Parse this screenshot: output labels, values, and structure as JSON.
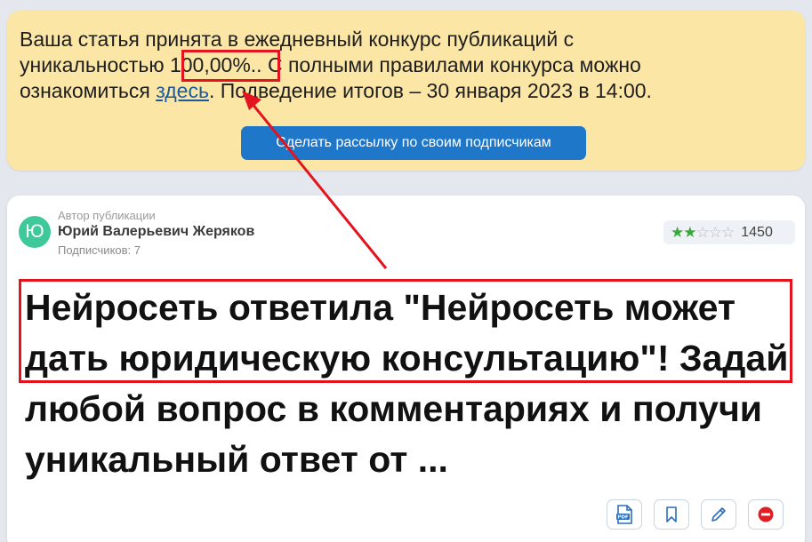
{
  "notice": {
    "line1": "Ваша статья принята в ежедневный конкурс публикаций с",
    "line2_prefix": "уникальностью ",
    "uniqueness": "100,00%.",
    "line2_suffix": ". С полными правилами конкурса можно",
    "line3_prefix": "ознакомиться ",
    "link_text": "здесь",
    "line3_suffix": ". Подведение итогов – 30 января 2023 в 14:00.",
    "button_label": "Сделать рассылку по своим подписчикам"
  },
  "author": {
    "avatar_letter": "Ю",
    "caption": "Автор публикации",
    "name": "Юрий Валерьевич Жеряков",
    "subscribers": "Подписчиков: 7"
  },
  "rating": {
    "stars_filled": 2,
    "stars_total": 5,
    "count": "1450"
  },
  "article": {
    "title": "Нейросеть ответила \"Нейросеть может дать юридическую консультацию\"! Задай любой вопрос в комментариях и получи уникальный ответ от ..."
  },
  "actions": {
    "icons": [
      "pdf-icon",
      "bookmark-icon",
      "pencil-icon",
      "block-icon"
    ]
  },
  "colors": {
    "notice_bg": "#fbe6a6",
    "button_blue": "#1f77c9",
    "annotation_red": "#e3141e",
    "star_green": "#37a83a"
  }
}
